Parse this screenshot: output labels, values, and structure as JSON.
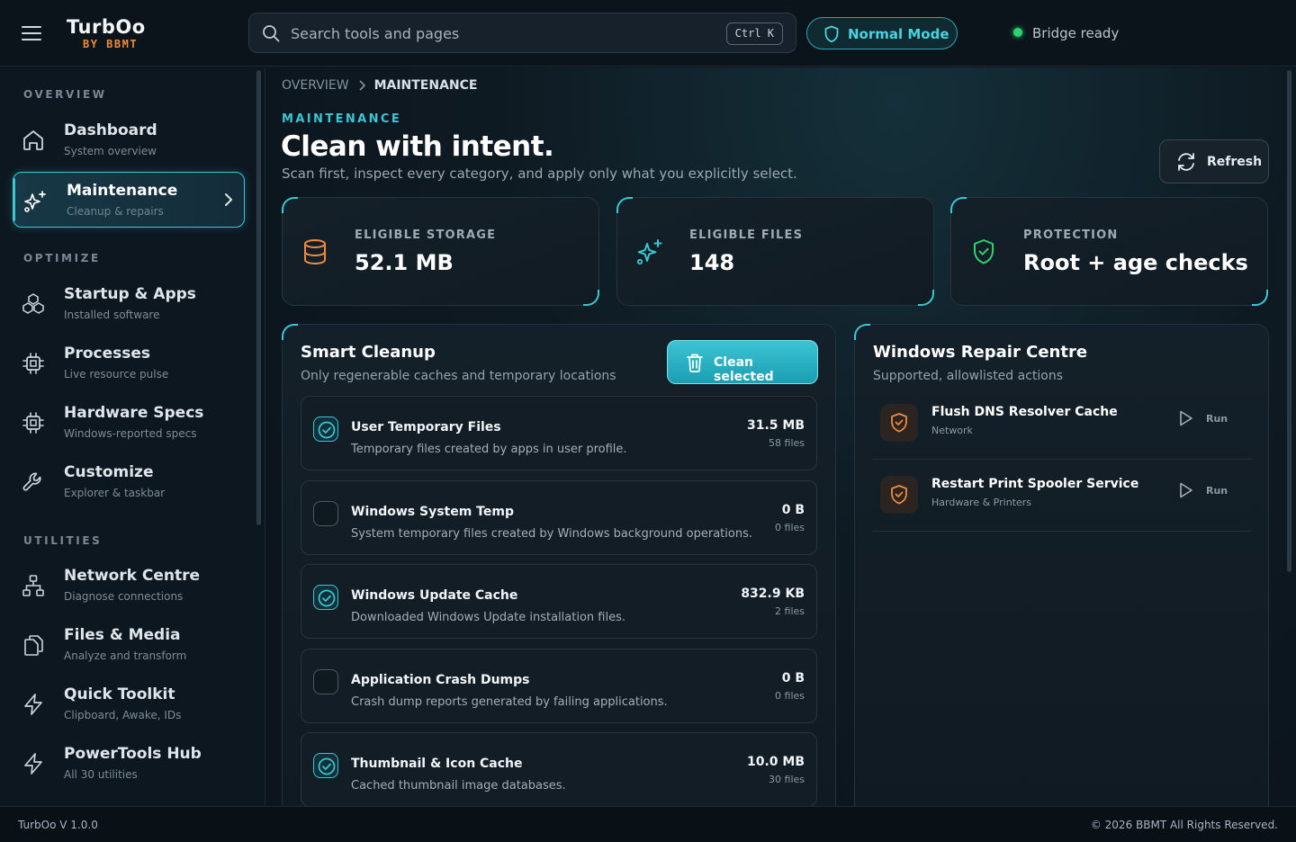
{
  "app": {
    "title": "TurbOo",
    "subtitle": "BY BBMT"
  },
  "search": {
    "placeholder": "Search tools and pages",
    "shortcut": "Ctrl K"
  },
  "mode": {
    "label": "Normal Mode"
  },
  "status": {
    "label": "Bridge ready",
    "color": "#2fd36e"
  },
  "sidebar": {
    "sections": [
      "OVERVIEW",
      "OPTIMIZE",
      "UTILITIES"
    ],
    "items": [
      {
        "title": "Dashboard",
        "sub": "System overview",
        "icon": "home-icon"
      },
      {
        "title": "Maintenance",
        "sub": "Cleanup & repairs",
        "icon": "sparkles-icon",
        "active": true
      },
      {
        "title": "Startup & Apps",
        "sub": "Installed software",
        "icon": "boxes-icon"
      },
      {
        "title": "Processes",
        "sub": "Live resource pulse",
        "icon": "cpu-icon"
      },
      {
        "title": "Hardware Specs",
        "sub": "Windows-reported specs",
        "icon": "cpu-icon"
      },
      {
        "title": "Customize",
        "sub": "Explorer & taskbar",
        "icon": "wrench-icon"
      },
      {
        "title": "Network Centre",
        "sub": "Diagnose connections",
        "icon": "network-icon"
      },
      {
        "title": "Files & Media",
        "sub": "Analyze and transform",
        "icon": "files-icon"
      },
      {
        "title": "Quick Toolkit",
        "sub": "Clipboard, Awake, IDs",
        "icon": "bolt-icon"
      },
      {
        "title": "PowerTools Hub",
        "sub": "All 30 utilities",
        "icon": "bolt-icon"
      }
    ]
  },
  "breadcrumb": {
    "root": "OVERVIEW",
    "current": "MAINTENANCE"
  },
  "page": {
    "eyebrow": "MAINTENANCE",
    "title": "Clean with intent.",
    "lead": "Scan first, inspect every category, and apply only what you explicitly select.",
    "refresh_label": "Refresh"
  },
  "stats": [
    {
      "label": "ELIGIBLE STORAGE",
      "value": "52.1 MB",
      "icon": "database-icon",
      "color": "#f08a3c"
    },
    {
      "label": "ELIGIBLE FILES",
      "value": "148",
      "icon": "sparkles-icon",
      "color": "#3cc6d4"
    },
    {
      "label": "PROTECTION",
      "value": "Root + age checks",
      "icon": "shield-check-icon",
      "color": "#2fd36e"
    }
  ],
  "smart_cleanup": {
    "title": "Smart Cleanup",
    "subtitle": "Only regenerable caches and temporary locations",
    "button_label": "Clean selected",
    "items": [
      {
        "title": "User Temporary Files",
        "desc": "Temporary files created by apps in user profile.",
        "size": "31.5 MB",
        "files": "58 files",
        "checked": true
      },
      {
        "title": "Windows System Temp",
        "desc": "System temporary files created by Windows background operations.",
        "size": "0 B",
        "files": "0 files",
        "checked": false
      },
      {
        "title": "Windows Update Cache",
        "desc": "Downloaded Windows Update installation files.",
        "size": "832.9 KB",
        "files": "2 files",
        "checked": true
      },
      {
        "title": "Application Crash Dumps",
        "desc": "Crash dump reports generated by failing applications.",
        "size": "0 B",
        "files": "0 files",
        "checked": false
      },
      {
        "title": "Thumbnail & Icon Cache",
        "desc": "Cached thumbnail image databases.",
        "size": "10.0 MB",
        "files": "30 files",
        "checked": true
      }
    ]
  },
  "repair_centre": {
    "title": "Windows Repair Centre",
    "subtitle": "Supported, allowlisted actions",
    "run_label": "Run",
    "items": [
      {
        "title": "Flush DNS Resolver Cache",
        "category": "Network"
      },
      {
        "title": "Restart Print Spooler Service",
        "category": "Hardware & Printers"
      }
    ]
  },
  "footer": {
    "version": "TurbOo V 1.0.0",
    "copyright": "© 2026 BBMT All Rights Reserved."
  },
  "colors": {
    "accent": "#3cc6d4",
    "warning": "#f08a3c",
    "success": "#2fd36e",
    "background": "#0c151d"
  }
}
